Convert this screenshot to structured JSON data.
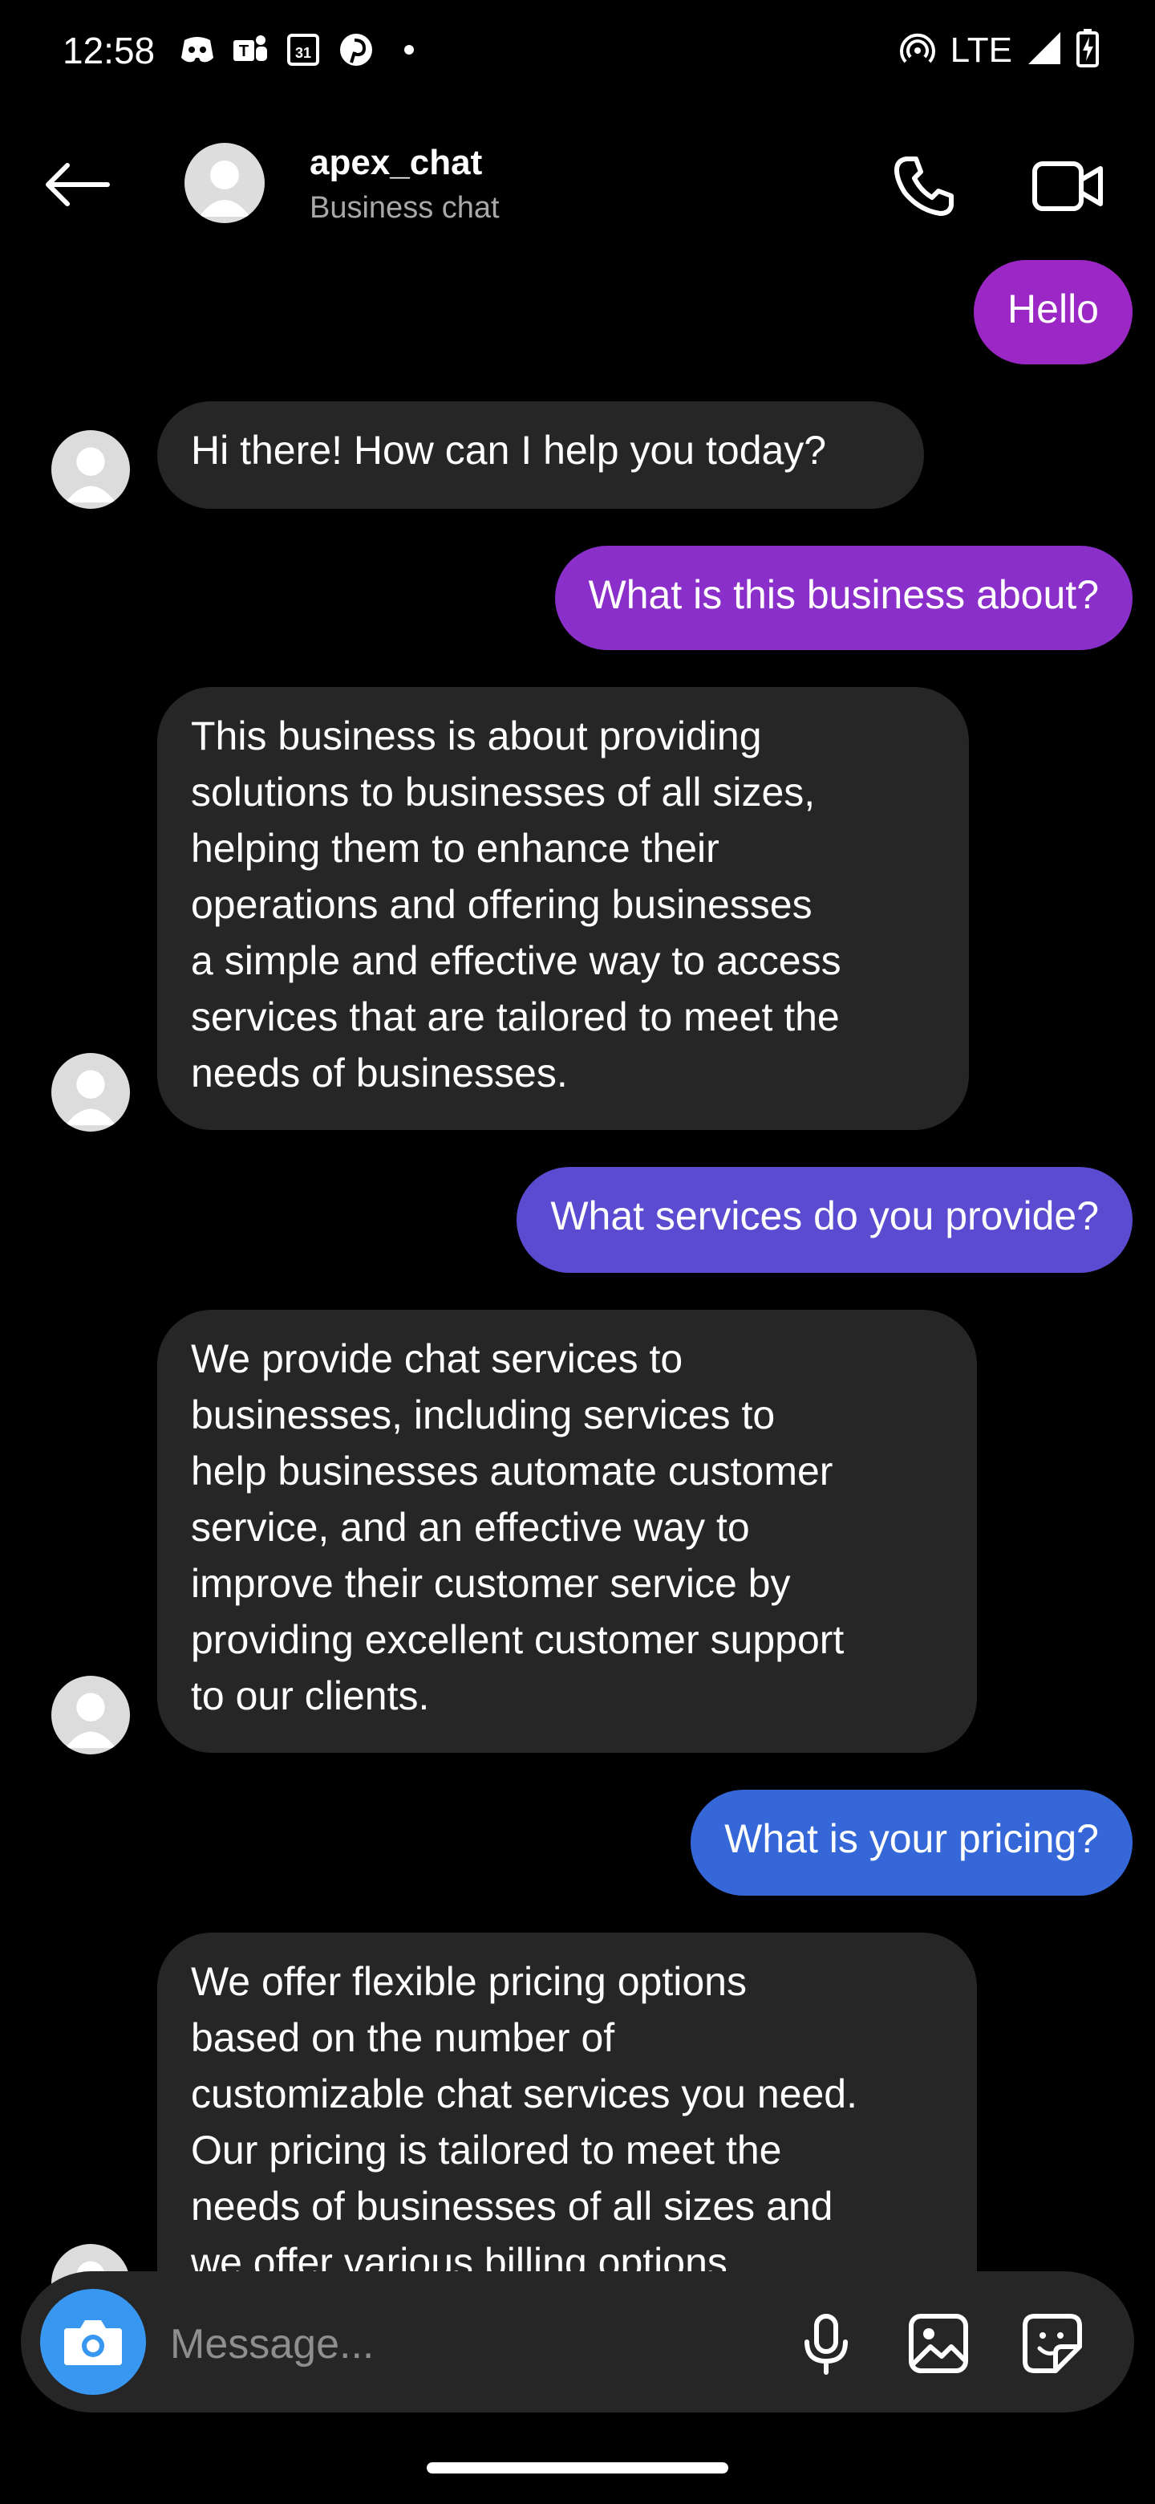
{
  "status_bar": {
    "time": "12:58",
    "network": "LTE"
  },
  "header": {
    "title": "apex_chat",
    "subtitle": "Business chat"
  },
  "messages": [
    {
      "from": "user",
      "text": "Hello",
      "color": "#9b27c5"
    },
    {
      "from": "business",
      "text": "Hi there! How can I help you today?"
    },
    {
      "from": "user",
      "text": "What is this business about?",
      "color": "#8a2fc9"
    },
    {
      "from": "business",
      "text": "This business is about providing\nsolutions to businesses of all sizes,\nhelping them to enhance their\noperations and offering businesses\na simple and effective way to access\nservices that are tailored to meet the\nneeds of businesses."
    },
    {
      "from": "user",
      "text": "What services do you provide?",
      "color": "#5a4bd0"
    },
    {
      "from": "business",
      "text": "We provide chat services to\nbusinesses, including services to\nhelp businesses automate customer\nservice, and an effective way to\nimprove their customer service by\nproviding excellent customer support\nto our clients."
    },
    {
      "from": "user",
      "text": "What is your pricing?",
      "color": "#3567d8"
    },
    {
      "from": "business",
      "text": "We offer flexible pricing options\nbased on the number of\ncustomizable chat services you need.\nOur pricing is tailored to meet the\nneeds of businesses of all sizes and\nwe offer various billing options"
    }
  ],
  "composer": {
    "placeholder": "Message..."
  },
  "icons": {
    "back": "arrow-left-icon",
    "call": "phone-icon",
    "video": "video-camera-icon",
    "camera": "camera-icon",
    "mic": "microphone-icon",
    "gallery": "image-icon",
    "sticker": "sticker-icon"
  }
}
